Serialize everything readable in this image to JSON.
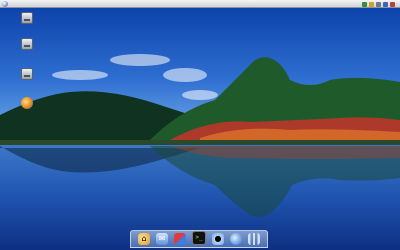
{
  "desktop": {
    "icons": [
      {
        "label": "",
        "icon": "hard-drive-icon"
      },
      {
        "label": "",
        "icon": "hard-drive-icon"
      },
      {
        "label": "",
        "icon": "hard-drive-icon"
      },
      {
        "label": "",
        "icon": "browser-icon"
      }
    ]
  },
  "topbar": {
    "menu_icon": "start-orb-icon",
    "tray": [
      "network-icon",
      "volume-icon",
      "battery-icon",
      "bluetooth-icon",
      "update-icon"
    ],
    "clock": ""
  },
  "dock": {
    "items": [
      {
        "icon": "home-icon",
        "glyph": "⌂"
      },
      {
        "icon": "mail-icon",
        "glyph": "✉"
      },
      {
        "icon": "apps-icon",
        "glyph": ""
      },
      {
        "icon": "terminal-icon",
        "glyph": ">_"
      },
      {
        "icon": "chat-icon",
        "glyph": "●"
      },
      {
        "icon": "globe-icon",
        "glyph": ""
      },
      {
        "icon": "settings-icon",
        "glyph": ""
      }
    ]
  },
  "colors": {
    "sky_top": "#0a3ea8",
    "sky_bottom": "#5fa0e6",
    "water": "#1c4aa0",
    "foliage": "#c7342a",
    "forest": "#1f5a2a"
  }
}
